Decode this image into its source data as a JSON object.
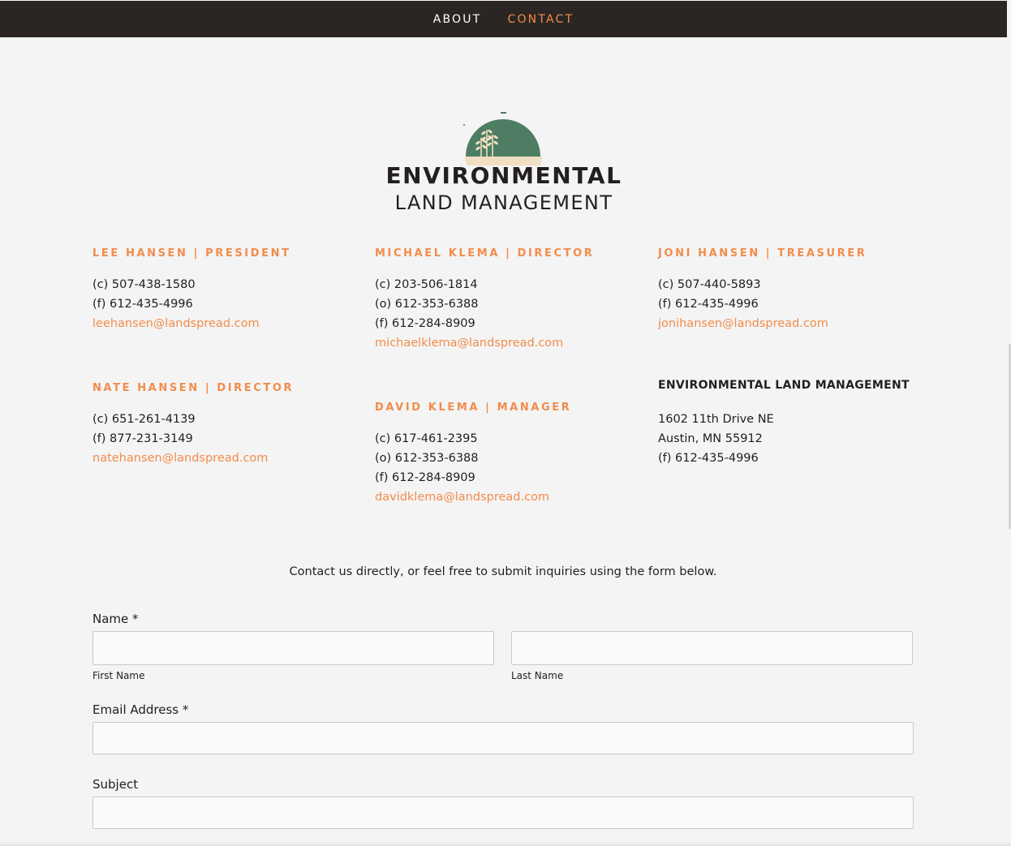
{
  "nav": {
    "items": [
      {
        "label": "ABOUT",
        "active": false
      },
      {
        "label": "CONTACT",
        "active": true
      }
    ],
    "background_color": "#2b2623",
    "accent_color": "#f28c4b"
  },
  "logo": {
    "line1": "ENVIRONMENTAL",
    "line2": "LAND MANAGEMENT",
    "sun_color": "#4d7d63",
    "ground_color": "#f0dfc2"
  },
  "contacts": [
    {
      "heading": "LEE HANSEN | PRESIDENT",
      "lines": [
        "(c) 507-438-1580",
        "(f) 612-435-4996"
      ],
      "email": "leehansen@landspread.com"
    },
    {
      "heading": "MICHAEL KLEMA | DIRECTOR",
      "lines": [
        "(c) 203-506-1814",
        "(o) 612-353-6388",
        "(f) 612-284-8909"
      ],
      "email": "michaelklema@landspread.com"
    },
    {
      "heading": "JONI HANSEN | TREASURER",
      "lines": [
        "(c) 507-440-5893",
        "(f) 612-435-4996"
      ],
      "email": "jonihansen@landspread.com"
    },
    {
      "heading": "NATE HANSEN | DIRECTOR",
      "lines": [
        "(c) 651-261-4139",
        "(f) 877-231-3149"
      ],
      "email": "natehansen@landspread.com"
    },
    {
      "heading": "DAVID KLEMA | MANAGER",
      "lines": [
        "(c) 617-461-2395",
        "(o) 612-353-6388",
        "(f) 612-284-8909"
      ],
      "email": "davidklema@landspread.com"
    }
  ],
  "company": {
    "heading": "ENVIRONMENTAL LAND MANAGEMENT",
    "lines": [
      "1602 11th Drive NE",
      "Austin, MN 55912",
      "(f) 612-435-4996"
    ]
  },
  "intro_text": "Contact us directly, or feel free to submit inquiries using the form below.",
  "form": {
    "name_label": "Name *",
    "first_name_label": "First Name",
    "first_name_value": "",
    "last_name_label": "Last Name",
    "last_name_value": "",
    "email_label": "Email Address *",
    "email_value": "",
    "subject_label": "Subject",
    "subject_value": ""
  }
}
